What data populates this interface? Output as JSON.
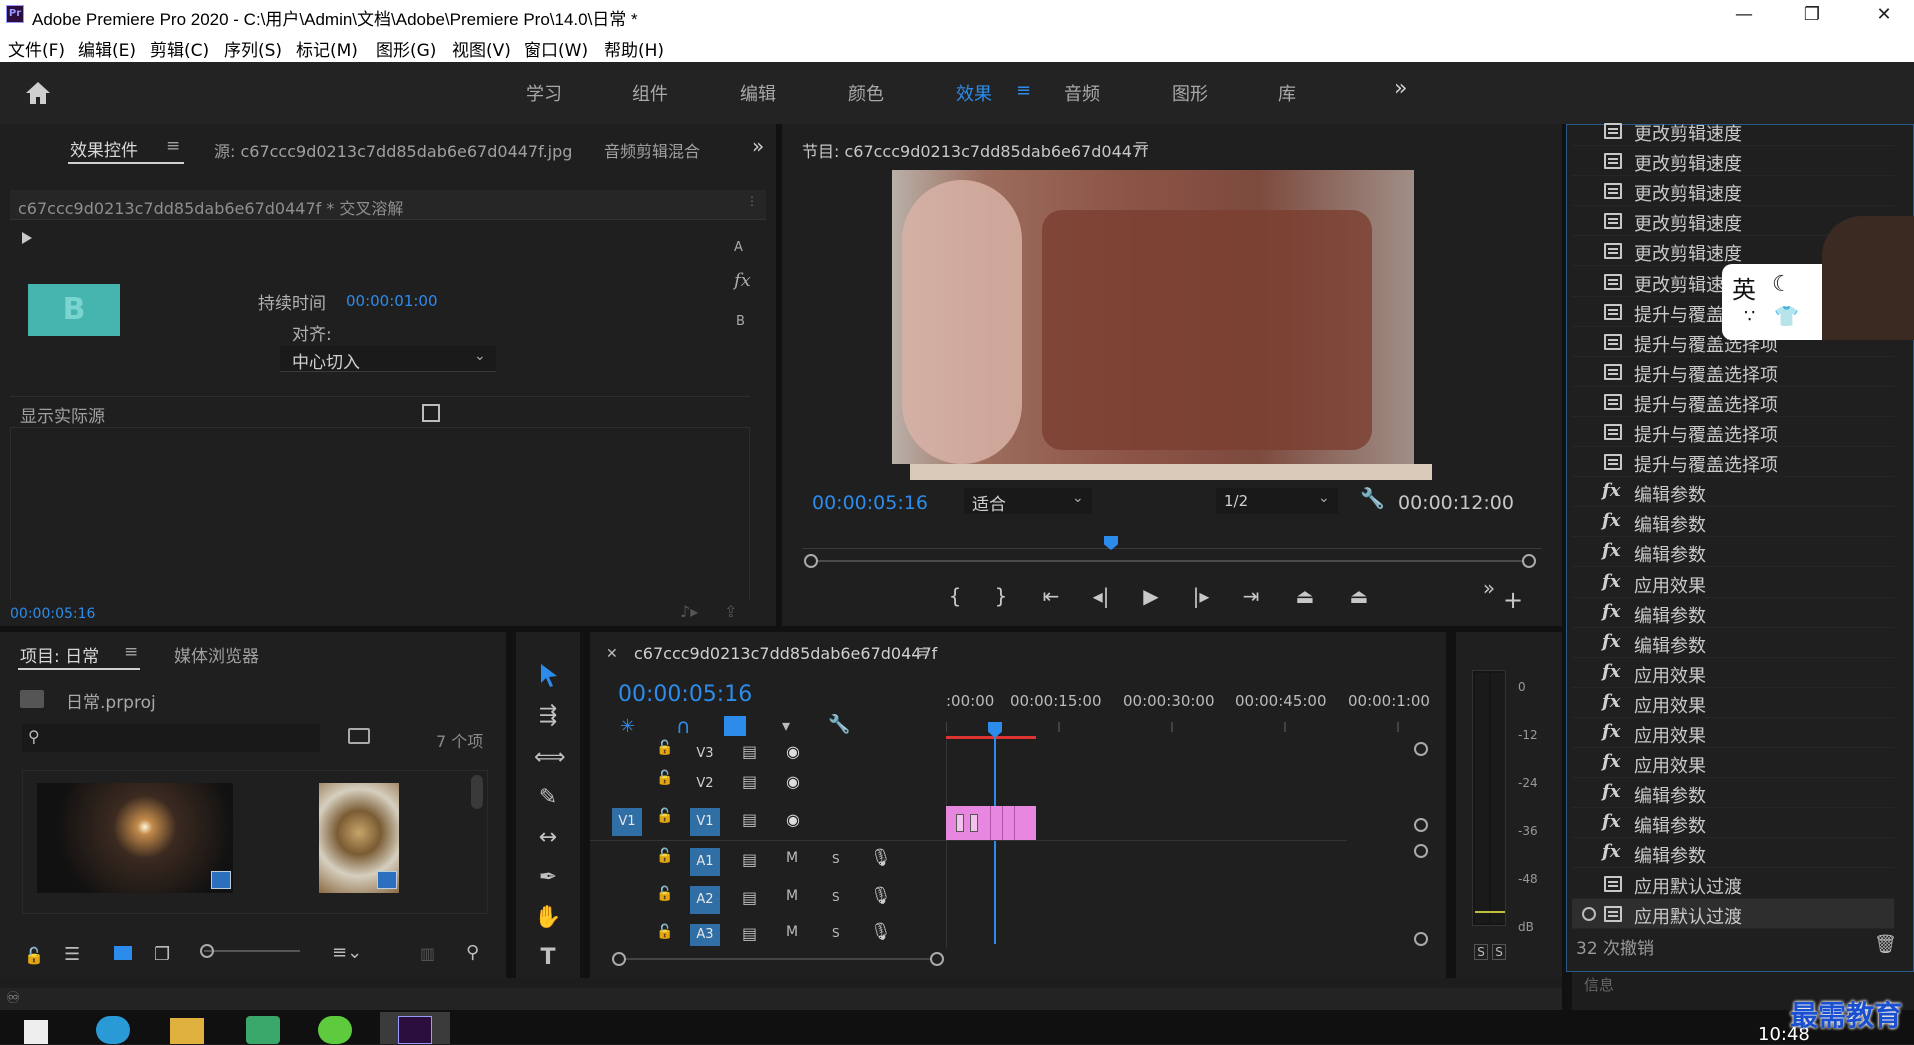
{
  "window": {
    "title": "Adobe Premiere Pro 2020 - C:\\用户\\Admin\\文档\\Adobe\\Premiere Pro\\14.0\\日常 *",
    "app_icon": "Pr",
    "minimize": "—",
    "restore": "❐",
    "close": "✕"
  },
  "menu": [
    "文件(F)",
    "编辑(E)",
    "剪辑(C)",
    "序列(S)",
    "标记(M)",
    "图形(G)",
    "视图(V)",
    "窗口(W)",
    "帮助(H)"
  ],
  "workspaces": {
    "tabs": [
      "学习",
      "组件",
      "编辑",
      "颜色",
      "效果",
      "音频",
      "图形",
      "库"
    ],
    "active": "效果",
    "menu_glyph": "≡",
    "more": "»"
  },
  "effect_controls": {
    "tab_label": "效果控件",
    "source_label": "源: c67ccc9d0213c7dd85dab6e67d0447f.jpg",
    "audio_mixer_label": "音频剪辑混合",
    "clip_title": "c67ccc9d0213c7dd85dab6e67d0447f * 交叉溶解",
    "duration_label": "持续时间",
    "duration_value": "00:00:01:00",
    "alignment_label": "对齐:",
    "alignment_value": "中心切入",
    "show_actual_source_label": "显示实际源",
    "thumb_letter": "B",
    "side_a": "A",
    "side_fx": "fx",
    "side_b": "B",
    "timecode": "00:00:05:16"
  },
  "program_monitor": {
    "title": "节目: c67ccc9d0213c7dd85dab6e67d0447f",
    "current_time": "00:00:05:16",
    "fit_value": "适合",
    "resolution_value": "1/2",
    "duration": "00:00:12:00"
  },
  "history": {
    "items": [
      {
        "icon": "doc",
        "label": "更改剪辑速度"
      },
      {
        "icon": "doc",
        "label": "更改剪辑速度"
      },
      {
        "icon": "doc",
        "label": "更改剪辑速度"
      },
      {
        "icon": "doc",
        "label": "更改剪辑速度"
      },
      {
        "icon": "doc",
        "label": "更改剪辑速度"
      },
      {
        "icon": "doc",
        "label": "更改剪辑速度"
      },
      {
        "icon": "doc",
        "label": "提升与覆盖选择项"
      },
      {
        "icon": "doc",
        "label": "提升与覆盖选择项"
      },
      {
        "icon": "doc",
        "label": "提升与覆盖选择项"
      },
      {
        "icon": "doc",
        "label": "提升与覆盖选择项"
      },
      {
        "icon": "doc",
        "label": "提升与覆盖选择项"
      },
      {
        "icon": "doc",
        "label": "提升与覆盖选择项"
      },
      {
        "icon": "fx",
        "label": "编辑参数"
      },
      {
        "icon": "fx",
        "label": "编辑参数"
      },
      {
        "icon": "fx",
        "label": "编辑参数"
      },
      {
        "icon": "fx",
        "label": "应用效果"
      },
      {
        "icon": "fx",
        "label": "编辑参数"
      },
      {
        "icon": "fx",
        "label": "编辑参数"
      },
      {
        "icon": "fx",
        "label": "应用效果"
      },
      {
        "icon": "fx",
        "label": "应用效果"
      },
      {
        "icon": "fx",
        "label": "应用效果"
      },
      {
        "icon": "fx",
        "label": "应用效果"
      },
      {
        "icon": "fx",
        "label": "编辑参数"
      },
      {
        "icon": "fx",
        "label": "编辑参数"
      },
      {
        "icon": "fx",
        "label": "编辑参数"
      },
      {
        "icon": "doc",
        "label": "应用默认过渡"
      },
      {
        "icon": "doc",
        "label": "应用默认过渡"
      }
    ],
    "undo_count": "32 次撤销",
    "next_panel_label": "信息",
    "ime_badge": "英"
  },
  "project": {
    "tab_label": "项目: 日常",
    "media_browser_label": "媒体浏览器",
    "project_file": "日常.prproj",
    "item_count": "7 个项"
  },
  "timeline": {
    "sequence_name": "c67ccc9d0213c7dd85dab6e67d0447f",
    "current_time": "00:00:05:16",
    "ruler_labels": [
      ":00:00",
      "00:00:15:00",
      "00:00:30:00",
      "00:00:45:00",
      "00:00:1:00"
    ],
    "video_tracks": [
      "V3",
      "V2",
      "V1"
    ],
    "audio_tracks": [
      "A1",
      "A2",
      "A3"
    ],
    "source_patch": "V1",
    "mute_label": "M",
    "solo_label": "S"
  },
  "audio_meter": {
    "labels": [
      "0",
      "-12",
      "-24",
      "-36",
      "-48",
      "dB"
    ],
    "solo_left": "S",
    "solo_right": "S"
  },
  "taskbar": {
    "clock": "10:48",
    "watermark": "最需教育"
  },
  "colors": {
    "accent": "#2d8ceb",
    "clip_pink": "#e887e0",
    "panel_bg": "#1f1f1f",
    "thumb_teal": "#46b5b0"
  }
}
